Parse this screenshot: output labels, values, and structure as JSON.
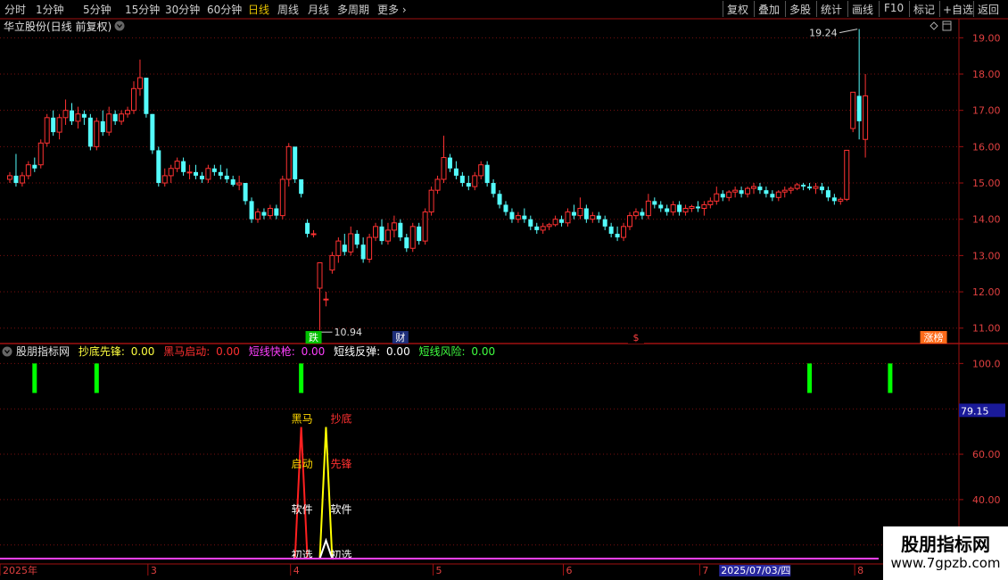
{
  "toolbar": {
    "periods": [
      {
        "label": "分时",
        "active": false
      },
      {
        "label": "1分钟",
        "active": false
      },
      {
        "label": "5分钟",
        "active": false
      },
      {
        "label": "15分钟",
        "active": false
      },
      {
        "label": "30分钟",
        "active": false
      },
      {
        "label": "60分钟",
        "active": false
      },
      {
        "label": "日线",
        "active": true
      },
      {
        "label": "周线",
        "active": false
      },
      {
        "label": "月线",
        "active": false
      },
      {
        "label": "多周期",
        "active": false
      },
      {
        "label": "更多",
        "active": false
      }
    ],
    "more_icon": "chevron-right-icon",
    "right_buttons": [
      "复权",
      "叠加",
      "多股",
      "统计",
      "画线",
      "F10",
      "标记",
      "+自选",
      "返回"
    ]
  },
  "chart_data": [
    {
      "type": "candlestick",
      "title": "华立股份(日线 前复权)",
      "ylim": [
        10.6,
        19.5
      ],
      "yticks": [
        "19.00",
        "18.00",
        "17.00",
        "16.00",
        "15.00",
        "14.00",
        "13.00",
        "12.00",
        "11.00"
      ],
      "high_label": "19.24",
      "low_label": "10.94",
      "colors": {
        "up": "#ff3232",
        "down": "#54fcfc"
      },
      "markers": [
        {
          "label": "跌",
          "color": "#00c000",
          "text_color": "#ffffff",
          "index": 49
        },
        {
          "label": "财",
          "color": "#1e2f7a",
          "text_color": "#ffffff",
          "index": 63
        },
        {
          "label": "$",
          "color": "#000000",
          "text_color": "#ff4040",
          "index": 101
        },
        {
          "label": "涨榜",
          "color": "#ff6b1a",
          "text_color": "#ffffff",
          "index": 149
        }
      ],
      "candles": [
        [
          15.1,
          15.3,
          15.0,
          15.2
        ],
        [
          15.2,
          15.8,
          14.9,
          15.0
        ],
        [
          15.0,
          15.3,
          14.9,
          15.2
        ],
        [
          15.2,
          15.6,
          15.1,
          15.5
        ],
        [
          15.5,
          15.7,
          15.3,
          15.4
        ],
        [
          15.5,
          16.2,
          15.4,
          16.1
        ],
        [
          16.1,
          16.9,
          16.0,
          16.8
        ],
        [
          16.8,
          17.0,
          16.3,
          16.4
        ],
        [
          16.4,
          16.9,
          16.2,
          16.8
        ],
        [
          16.8,
          17.3,
          16.6,
          17.0
        ],
        [
          17.0,
          17.2,
          16.6,
          16.7
        ],
        [
          16.7,
          17.1,
          16.5,
          16.9
        ],
        [
          16.9,
          17.0,
          16.6,
          16.8
        ],
        [
          16.8,
          16.9,
          15.9,
          16.0
        ],
        [
          16.0,
          16.8,
          15.9,
          16.7
        ],
        [
          16.7,
          17.0,
          16.3,
          16.4
        ],
        [
          16.4,
          17.1,
          16.3,
          16.9
        ],
        [
          16.9,
          17.0,
          16.6,
          16.7
        ],
        [
          16.7,
          17.0,
          16.6,
          16.9
        ],
        [
          16.9,
          17.1,
          16.8,
          17.0
        ],
        [
          17.0,
          17.8,
          16.9,
          17.6
        ],
        [
          17.6,
          18.4,
          17.4,
          17.9
        ],
        [
          17.9,
          17.9,
          16.8,
          16.9
        ],
        [
          16.9,
          16.9,
          15.8,
          15.9
        ],
        [
          15.9,
          16.0,
          14.9,
          15.0
        ],
        [
          15.0,
          15.4,
          14.9,
          15.2
        ],
        [
          15.2,
          15.5,
          15.0,
          15.4
        ],
        [
          15.4,
          15.7,
          15.3,
          15.6
        ],
        [
          15.6,
          15.7,
          15.2,
          15.3
        ],
        [
          15.3,
          15.5,
          15.1,
          15.3
        ],
        [
          15.3,
          15.5,
          15.1,
          15.2
        ],
        [
          15.2,
          15.3,
          15.0,
          15.1
        ],
        [
          15.1,
          15.5,
          15.0,
          15.4
        ],
        [
          15.4,
          15.5,
          15.2,
          15.3
        ],
        [
          15.3,
          15.5,
          15.1,
          15.2
        ],
        [
          15.2,
          15.4,
          15.0,
          15.1
        ],
        [
          15.1,
          15.2,
          14.9,
          14.95
        ],
        [
          14.95,
          15.2,
          14.8,
          15.0
        ],
        [
          15.0,
          15.0,
          14.4,
          14.5
        ],
        [
          14.5,
          14.6,
          13.9,
          14.0
        ],
        [
          14.0,
          14.3,
          13.9,
          14.2
        ],
        [
          14.2,
          14.3,
          14.0,
          14.1
        ],
        [
          14.1,
          14.4,
          14.0,
          14.3
        ],
        [
          14.3,
          14.4,
          14.0,
          14.1
        ],
        [
          14.1,
          15.2,
          14.0,
          15.1
        ],
        [
          15.1,
          16.1,
          14.9,
          16.0
        ],
        [
          16.0,
          16.0,
          15.0,
          15.1
        ],
        [
          15.1,
          15.0,
          14.6,
          14.7
        ],
        [
          13.9,
          14.0,
          13.5,
          13.6
        ],
        [
          13.6,
          13.7,
          13.5,
          13.6
        ],
        [
          12.1,
          12.8,
          10.94,
          12.8
        ],
        [
          11.8,
          12.0,
          11.6,
          11.8
        ],
        [
          12.6,
          13.1,
          12.5,
          13.0
        ],
        [
          13.0,
          13.5,
          12.8,
          13.4
        ],
        [
          13.3,
          13.6,
          13.0,
          13.1
        ],
        [
          13.1,
          13.8,
          13.0,
          13.6
        ],
        [
          13.6,
          13.7,
          13.2,
          13.3
        ],
        [
          13.3,
          13.5,
          12.8,
          12.9
        ],
        [
          12.9,
          13.6,
          12.8,
          13.5
        ],
        [
          13.5,
          13.9,
          13.4,
          13.8
        ],
        [
          13.8,
          14.0,
          13.3,
          13.4
        ],
        [
          13.4,
          13.9,
          13.3,
          13.7
        ],
        [
          13.7,
          14.1,
          13.5,
          13.9
        ],
        [
          13.9,
          14.0,
          13.4,
          13.5
        ],
        [
          13.5,
          13.6,
          13.1,
          13.2
        ],
        [
          13.2,
          13.9,
          13.1,
          13.8
        ],
        [
          13.8,
          13.9,
          13.3,
          13.4
        ],
        [
          13.4,
          14.3,
          13.3,
          14.2
        ],
        [
          14.2,
          14.9,
          14.1,
          14.8
        ],
        [
          14.8,
          15.2,
          14.7,
          15.1
        ],
        [
          15.1,
          16.3,
          15.0,
          15.7
        ],
        [
          15.7,
          15.8,
          15.3,
          15.4
        ],
        [
          15.4,
          15.6,
          15.1,
          15.2
        ],
        [
          15.2,
          15.3,
          14.9,
          15.0
        ],
        [
          15.0,
          15.2,
          14.8,
          14.9
        ],
        [
          14.9,
          15.3,
          14.8,
          15.2
        ],
        [
          15.2,
          15.6,
          15.1,
          15.5
        ],
        [
          15.5,
          15.6,
          14.9,
          15.0
        ],
        [
          15.0,
          15.1,
          14.6,
          14.7
        ],
        [
          14.7,
          14.8,
          14.3,
          14.4
        ],
        [
          14.4,
          14.5,
          14.1,
          14.2
        ],
        [
          14.2,
          14.3,
          13.9,
          14.0
        ],
        [
          14.0,
          14.2,
          13.9,
          14.1
        ],
        [
          14.1,
          14.3,
          13.9,
          14.0
        ],
        [
          14.0,
          14.1,
          13.7,
          13.8
        ],
        [
          13.8,
          13.9,
          13.6,
          13.7
        ],
        [
          13.7,
          13.9,
          13.6,
          13.8
        ],
        [
          13.8,
          13.9,
          13.7,
          13.85
        ],
        [
          13.85,
          14.1,
          13.8,
          14.0
        ],
        [
          14.0,
          14.1,
          13.8,
          13.9
        ],
        [
          13.9,
          14.3,
          13.8,
          14.2
        ],
        [
          14.2,
          14.4,
          14.0,
          14.1
        ],
        [
          14.1,
          14.6,
          14.0,
          14.3
        ],
        [
          14.3,
          14.4,
          13.9,
          14.0
        ],
        [
          14.0,
          14.2,
          13.9,
          14.1
        ],
        [
          14.1,
          14.2,
          13.9,
          14.0
        ],
        [
          14.0,
          14.1,
          13.7,
          13.8
        ],
        [
          13.8,
          13.9,
          13.5,
          13.6
        ],
        [
          13.6,
          13.8,
          13.4,
          13.5
        ],
        [
          13.5,
          13.9,
          13.4,
          13.8
        ],
        [
          13.8,
          14.2,
          13.7,
          14.1
        ],
        [
          14.1,
          14.3,
          14.0,
          14.2
        ],
        [
          14.2,
          14.3,
          14.0,
          14.1
        ],
        [
          14.1,
          14.7,
          14.0,
          14.5
        ],
        [
          14.5,
          14.6,
          14.3,
          14.4
        ],
        [
          14.4,
          14.5,
          14.2,
          14.3
        ],
        [
          14.3,
          14.4,
          14.1,
          14.2
        ],
        [
          14.2,
          14.5,
          14.1,
          14.4
        ],
        [
          14.4,
          14.5,
          14.1,
          14.2
        ],
        [
          14.2,
          14.4,
          14.1,
          14.3
        ],
        [
          14.3,
          14.4,
          14.2,
          14.35
        ],
        [
          14.35,
          14.5,
          14.2,
          14.3
        ],
        [
          14.3,
          14.5,
          14.1,
          14.4
        ],
        [
          14.4,
          14.6,
          14.3,
          14.5
        ],
        [
          14.5,
          14.9,
          14.4,
          14.7
        ],
        [
          14.7,
          14.8,
          14.5,
          14.6
        ],
        [
          14.6,
          14.8,
          14.5,
          14.75
        ],
        [
          14.75,
          14.9,
          14.6,
          14.8
        ],
        [
          14.8,
          14.9,
          14.6,
          14.7
        ],
        [
          14.7,
          14.9,
          14.6,
          14.85
        ],
        [
          14.85,
          15.0,
          14.7,
          14.9
        ],
        [
          14.9,
          15.0,
          14.7,
          14.8
        ],
        [
          14.8,
          14.9,
          14.6,
          14.7
        ],
        [
          14.7,
          14.8,
          14.5,
          14.6
        ],
        [
          14.6,
          14.8,
          14.5,
          14.75
        ],
        [
          14.75,
          14.9,
          14.6,
          14.8
        ],
        [
          14.8,
          14.9,
          14.7,
          14.85
        ],
        [
          14.85,
          15.0,
          14.8,
          14.95
        ],
        [
          14.95,
          15.0,
          14.8,
          14.9
        ],
        [
          14.9,
          15.0,
          14.8,
          14.85
        ],
        [
          14.85,
          15.0,
          14.7,
          14.9
        ],
        [
          14.9,
          15.0,
          14.7,
          14.8
        ],
        [
          14.8,
          14.9,
          14.5,
          14.6
        ],
        [
          14.6,
          14.7,
          14.4,
          14.5
        ],
        [
          14.5,
          14.6,
          14.4,
          14.55
        ],
        [
          14.55,
          15.9,
          14.5,
          15.9
        ],
        [
          16.5,
          17.5,
          16.4,
          17.5
        ],
        [
          17.4,
          19.24,
          16.2,
          16.7
        ],
        [
          16.2,
          18.0,
          15.7,
          17.4
        ]
      ]
    },
    {
      "type": "line",
      "title": "股朋指标网",
      "ylim": [
        14,
        108
      ],
      "yticks": [
        "100.0",
        "80.00",
        "60.00",
        "40.00",
        "20.00"
      ],
      "current_value_label": "79.15",
      "legend": [
        {
          "name": "抄底先锋:",
          "value": "0.00",
          "color": "#ffff40"
        },
        {
          "name": "黑马启动:",
          "value": "0.00",
          "color": "#ff3030"
        },
        {
          "name": "短线快枪:",
          "value": "0.00",
          "color": "#ff40ff"
        },
        {
          "name": "短线反弹:",
          "value": "0.00",
          "color": "#ffffff"
        },
        {
          "name": "短线风险:",
          "value": "0.00",
          "color": "#40ff40"
        }
      ],
      "signal_bar_indices": [
        4,
        14,
        47,
        129,
        142
      ],
      "signal_bar_color": "#00ff00",
      "signal_bar_range": [
        87,
        100
      ],
      "spikes": [
        {
          "name": "黑马启动",
          "color": "#ff2020",
          "start": 46,
          "peak": 47,
          "end": 48,
          "peak_value": 72
        },
        {
          "name": "抄底先锋",
          "color": "#ffff00",
          "start": 50,
          "peak": 51,
          "end": 52,
          "peak_value": 72
        },
        {
          "name": "白线",
          "color": "#ffffff",
          "start": 50,
          "peak": 51,
          "end": 52,
          "peak_value": 22
        }
      ],
      "texts_red_spike": [
        "黑马",
        "启动",
        "软件",
        "初选"
      ],
      "texts_yellow_spike": [
        "抄底",
        "先锋",
        "软件",
        "初选"
      ],
      "text_levels": [
        76,
        56,
        36,
        16
      ],
      "baseline_color": "#ff40ff"
    }
  ],
  "time_axis": {
    "labels": [
      {
        "text": "2025年",
        "index": 0
      },
      {
        "text": "3",
        "index": 23
      },
      {
        "text": "4",
        "index": 46
      },
      {
        "text": "5",
        "index": 69
      },
      {
        "text": "6",
        "index": 90
      },
      {
        "text": "7",
        "index": 112
      },
      {
        "text": "8",
        "index": 137
      }
    ],
    "highlight_date": "2025/07/03/四",
    "highlight_index": 115
  },
  "watermark": {
    "line1": "股朋指标网",
    "line2": "www.7gpzb.com"
  }
}
